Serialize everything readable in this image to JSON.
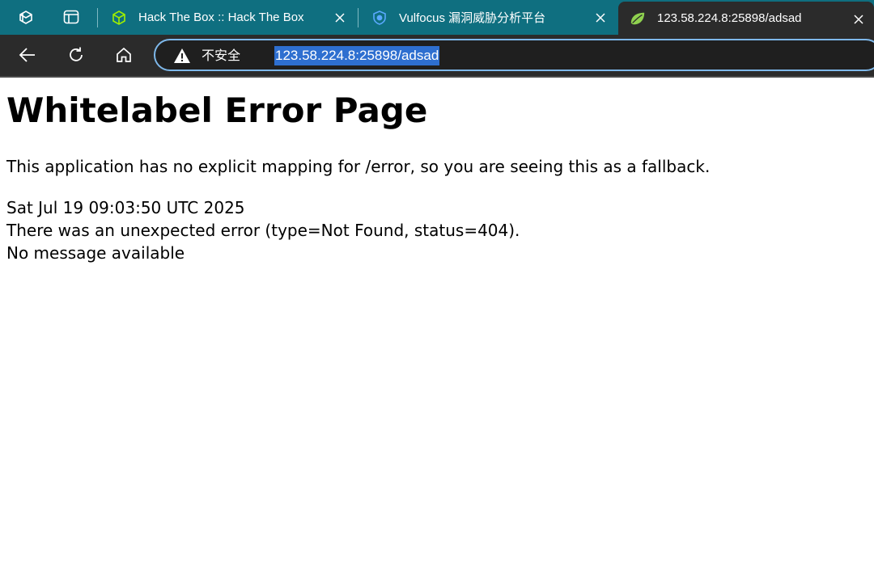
{
  "browser": {
    "tabs": [
      {
        "title": "Hack The Box :: Hack The Box",
        "favicon": "htb-cube-icon",
        "active": false
      },
      {
        "title": "Vulfocus 漏洞威胁分析平台",
        "favicon": "vulfocus-shield-icon",
        "active": false
      },
      {
        "title": "123.58.224.8:25898/adsad",
        "favicon": "spring-leaf-icon",
        "active": true
      }
    ],
    "address_bar": {
      "security_label": "不安全",
      "url": "123.58.224.8:25898/adsad"
    },
    "colors": {
      "tab_strip": "#0f6f80",
      "toolbar": "#2b2b2b",
      "omnibox_border": "#7eb8ea",
      "url_selection": "#2e6fd0"
    }
  },
  "page": {
    "heading": "Whitelabel Error Page",
    "intro": "This application has no explicit mapping for /error, so you are seeing this as a fallback.",
    "timestamp": "Sat Jul 19 09:03:50 UTC 2025",
    "error_line": "There was an unexpected error (type=Not Found, status=404).",
    "message_line": "No message available"
  }
}
